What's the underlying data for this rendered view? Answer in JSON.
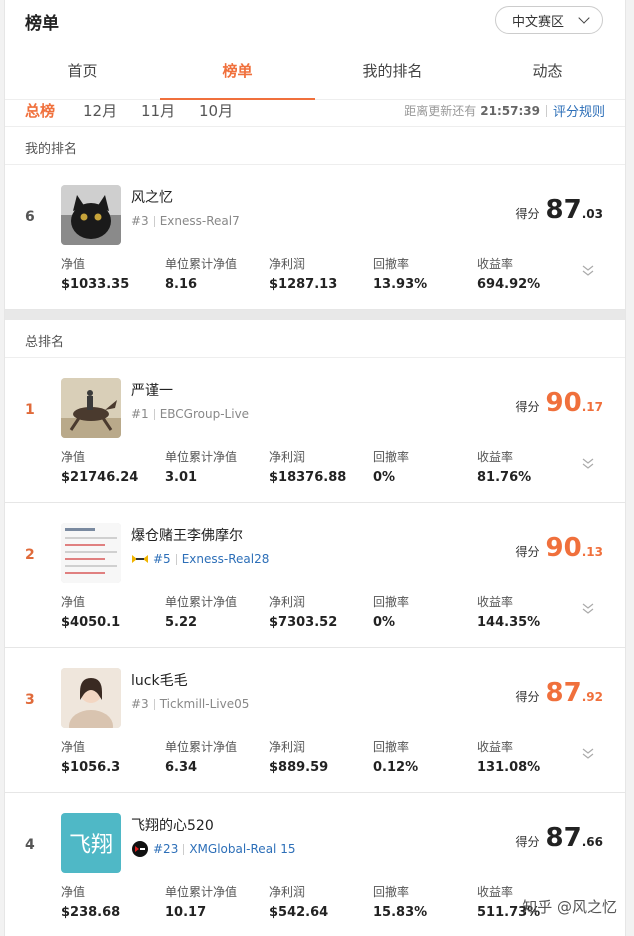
{
  "header": {
    "title": "榜单",
    "region": "中文赛区"
  },
  "tabs": [
    {
      "label": "首页"
    },
    {
      "label": "榜单"
    },
    {
      "label": "我的排名"
    },
    {
      "label": "动态"
    }
  ],
  "subtabs": [
    {
      "label": "总榜"
    },
    {
      "label": "12月"
    },
    {
      "label": "11月"
    },
    {
      "label": "10月"
    }
  ],
  "update": {
    "prefix": "距离更新还有",
    "countdown": "21:57:39",
    "rules_link": "评分规则"
  },
  "my_rank": {
    "section_label": "我的排名",
    "entry": {
      "rank": "6",
      "name": "风之忆",
      "num": "#3",
      "account": "Exness-Real7",
      "score_label": "得分",
      "score_int": "87",
      "score_dec": ".03",
      "stats": [
        {
          "k": "净值",
          "v": "$1033.35"
        },
        {
          "k": "单位累计净值",
          "v": "8.16"
        },
        {
          "k": "净利润",
          "v": "$1287.13"
        },
        {
          "k": "回撤率",
          "v": "13.93%"
        },
        {
          "k": "收益率",
          "v": "694.92%"
        }
      ]
    }
  },
  "overall": {
    "section_label": "总排名",
    "entries": [
      {
        "rank": "1",
        "name": "严谨一",
        "num": "#1",
        "account": "EBCGroup-Live",
        "score_label": "得分",
        "score_int": "90",
        "score_dec": ".17",
        "stats": [
          {
            "k": "净值",
            "v": "$21746.24"
          },
          {
            "k": "单位累计净值",
            "v": "3.01"
          },
          {
            "k": "净利润",
            "v": "$18376.88"
          },
          {
            "k": "回撤率",
            "v": "0%"
          },
          {
            "k": "收益率",
            "v": "81.76%"
          }
        ]
      },
      {
        "rank": "2",
        "name": "爆仓赌王李佛摩尔",
        "num": "#5",
        "account": "Exness-Real28",
        "score_label": "得分",
        "score_int": "90",
        "score_dec": ".13",
        "stats": [
          {
            "k": "净值",
            "v": "$4050.1"
          },
          {
            "k": "单位累计净值",
            "v": "5.22"
          },
          {
            "k": "净利润",
            "v": "$7303.52"
          },
          {
            "k": "回撤率",
            "v": "0%"
          },
          {
            "k": "收益率",
            "v": "144.35%"
          }
        ]
      },
      {
        "rank": "3",
        "name": "luck毛毛",
        "num": "#3",
        "account": "Tickmill-Live05",
        "score_label": "得分",
        "score_int": "87",
        "score_dec": ".92",
        "stats": [
          {
            "k": "净值",
            "v": "$1056.3"
          },
          {
            "k": "单位累计净值",
            "v": "6.34"
          },
          {
            "k": "净利润",
            "v": "$889.59"
          },
          {
            "k": "回撤率",
            "v": "0.12%"
          },
          {
            "k": "收益率",
            "v": "131.08%"
          }
        ]
      },
      {
        "rank": "4",
        "name": "飞翔的心520",
        "num": "#23",
        "account": "XMGlobal-Real 15",
        "avatar_text": "飞翔",
        "score_label": "得分",
        "score_int": "87",
        "score_dec": ".66",
        "stats": [
          {
            "k": "净值",
            "v": "$238.68"
          },
          {
            "k": "单位累计净值",
            "v": "10.17"
          },
          {
            "k": "净利润",
            "v": "$542.64"
          },
          {
            "k": "回撤率",
            "v": "15.83%"
          },
          {
            "k": "收益率",
            "v": "511.73%"
          }
        ]
      }
    ]
  },
  "watermark": "知乎 @风之忆",
  "colors": {
    "accent": "#f0703c",
    "link": "#2d6fb8"
  }
}
